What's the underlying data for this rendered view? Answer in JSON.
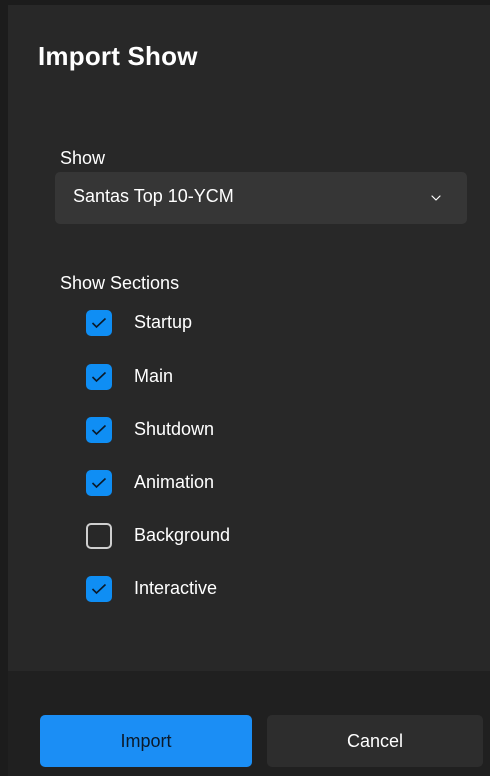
{
  "dialog": {
    "title": "Import Show",
    "show_label": "Show",
    "show_value": "Santas Top 10-YCM",
    "sections_label": "Show Sections",
    "sections": [
      {
        "label": "Startup",
        "checked": true
      },
      {
        "label": "Main",
        "checked": true
      },
      {
        "label": "Shutdown",
        "checked": true
      },
      {
        "label": "Animation",
        "checked": true
      },
      {
        "label": "Background",
        "checked": false
      },
      {
        "label": "Interactive",
        "checked": true
      }
    ],
    "import_label": "Import",
    "cancel_label": "Cancel"
  },
  "colors": {
    "accent": "#1b8ef5",
    "background": "#282828",
    "footer": "#202020"
  }
}
